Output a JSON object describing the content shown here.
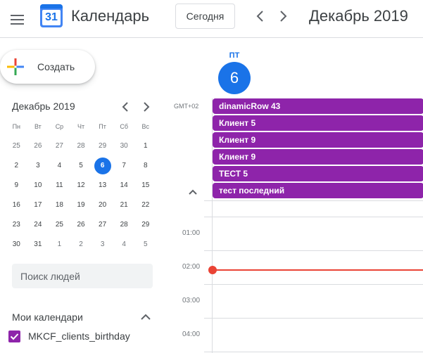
{
  "header": {
    "logo_text": "31",
    "app_title": "Календарь",
    "today_label": "Сегодня",
    "period_title": "Декабрь 2019"
  },
  "sidebar": {
    "create_label": "Создать",
    "mini_calendar": {
      "title": "Декабрь 2019",
      "weekdays": [
        "Пн",
        "Вт",
        "Ср",
        "Чт",
        "Пт",
        "Сб",
        "Вс"
      ],
      "weeks": [
        [
          {
            "d": "25",
            "other": true
          },
          {
            "d": "26",
            "other": true
          },
          {
            "d": "27",
            "other": true
          },
          {
            "d": "28",
            "other": true
          },
          {
            "d": "29",
            "other": true
          },
          {
            "d": "30",
            "other": true
          },
          {
            "d": "1"
          }
        ],
        [
          {
            "d": "2"
          },
          {
            "d": "3"
          },
          {
            "d": "4"
          },
          {
            "d": "5"
          },
          {
            "d": "6",
            "today": true
          },
          {
            "d": "7"
          },
          {
            "d": "8"
          }
        ],
        [
          {
            "d": "9"
          },
          {
            "d": "10"
          },
          {
            "d": "11"
          },
          {
            "d": "12"
          },
          {
            "d": "13"
          },
          {
            "d": "14"
          },
          {
            "d": "15"
          }
        ],
        [
          {
            "d": "16"
          },
          {
            "d": "17"
          },
          {
            "d": "18"
          },
          {
            "d": "19"
          },
          {
            "d": "20"
          },
          {
            "d": "21"
          },
          {
            "d": "22"
          }
        ],
        [
          {
            "d": "23"
          },
          {
            "d": "24"
          },
          {
            "d": "25"
          },
          {
            "d": "26"
          },
          {
            "d": "27"
          },
          {
            "d": "28"
          },
          {
            "d": "29"
          }
        ],
        [
          {
            "d": "30"
          },
          {
            "d": "31"
          },
          {
            "d": "1",
            "other": true
          },
          {
            "d": "2",
            "other": true
          },
          {
            "d": "3",
            "other": true
          },
          {
            "d": "4",
            "other": true
          },
          {
            "d": "5",
            "other": true
          }
        ]
      ]
    },
    "search_placeholder": "Поиск людей",
    "my_calendars": {
      "title": "Мои календари",
      "items": [
        {
          "label": "MKCF_clients_birthday",
          "checked": true,
          "color": "#8e24aa"
        }
      ]
    }
  },
  "day_view": {
    "day_name": "ПТ",
    "day_number": "6",
    "timezone": "GMT+02",
    "all_day_events": [
      "dinamicRow 43",
      "Клиент 5",
      "Клиент 9",
      "Клиент 9",
      "ТЕСТ 5",
      "тест последний"
    ],
    "event_color": "#8e24aa",
    "hours": [
      "01:00",
      "02:00",
      "03:00",
      "04:00"
    ],
    "now_indicator_color": "#ea4335"
  },
  "colors": {
    "accent": "#1a73e8",
    "text": "#3c4043",
    "muted": "#70757a",
    "divider": "#dadce0"
  },
  "icons": {
    "menu": "hamburger-menu-icon",
    "prev": "chevron-left-icon",
    "next": "chevron-right-icon",
    "create": "colorful-plus-icon",
    "collapse": "chevron-up-icon",
    "checkbox": "checkmark-icon"
  }
}
